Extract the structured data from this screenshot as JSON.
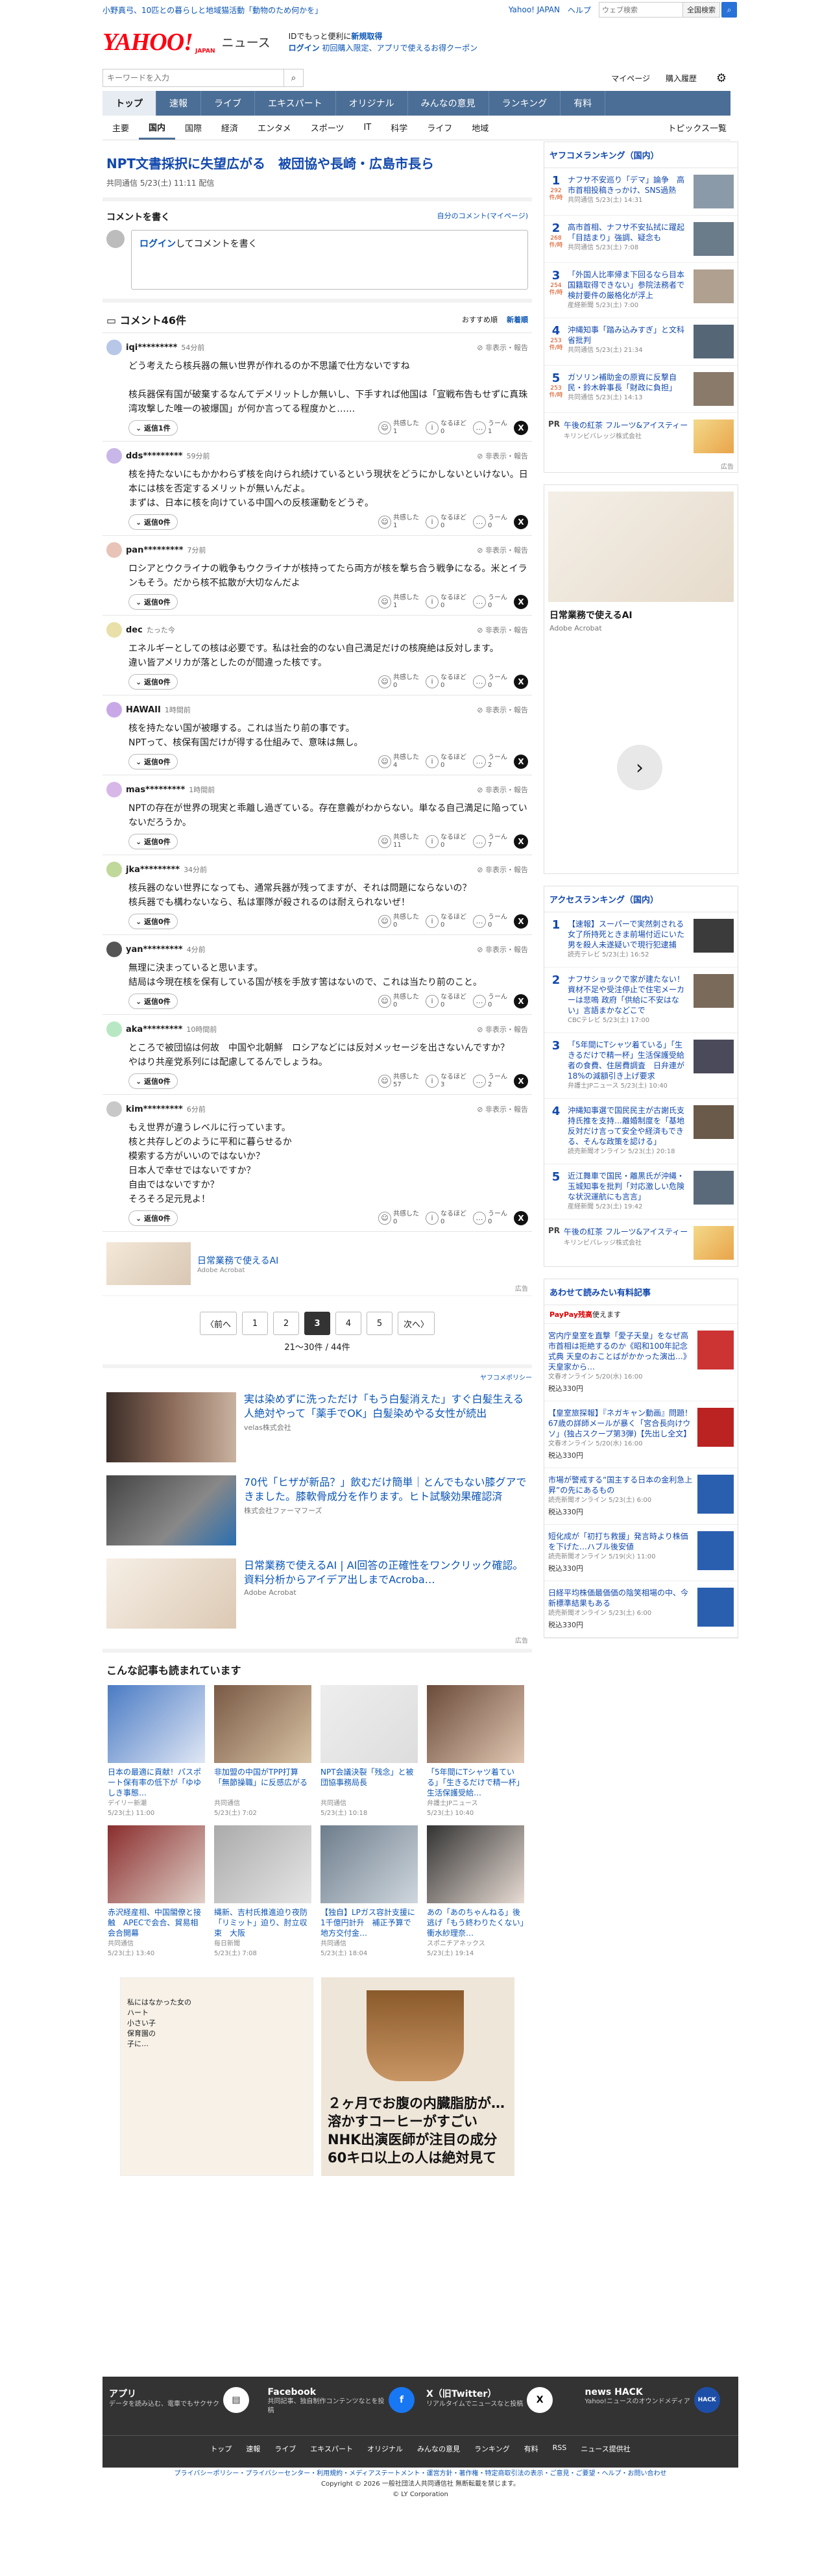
{
  "topbar": {
    "promo": "小野真弓、10匹との暮らしと地域猫活動「動物のため何かを」",
    "links": [
      "Yahoo! JAPAN",
      "ヘルプ"
    ],
    "search_placeholder": "ウェブ検索",
    "search_button": "全国検索"
  },
  "header": {
    "logo": "YAHOO!",
    "logo_sub": "JAPAN",
    "service": "ニュース",
    "promo1": "IDでもっと便利に",
    "promo1b": "新規取得",
    "promo2a": "ログイン",
    "promo2b": "初回購入限定、アプリで使えるお得クーポン"
  },
  "search": {
    "placeholder": "キーワードを入力",
    "mypage": "マイページ",
    "history": "購入履歴"
  },
  "nav": [
    "トップ",
    "速報",
    "ライブ",
    "エキスパート",
    "オリジナル",
    "みんなの意見",
    "ランキング",
    "有料"
  ],
  "subnav": [
    "主要",
    "国内",
    "国際",
    "経済",
    "エンタメ",
    "スポーツ",
    "IT",
    "科学",
    "ライフ",
    "地域"
  ],
  "subnav_right": "トピックス一覧",
  "article": {
    "title": "NPT文書採択に失望広がる　被団協や長崎・広島市長ら",
    "source": "共同通信",
    "date": "5/23(土) 11:11",
    "status": "配信"
  },
  "write": {
    "heading": "コメントを書く",
    "my_comments": "自分のコメント(マイページ)",
    "login": "ログイン",
    "rest": "してコメントを書く"
  },
  "comments_header": {
    "title": "コメント46件",
    "sort1": "おすすめ順",
    "sort2": "新着順"
  },
  "comments": [
    {
      "name": "iqi*********",
      "time": "54分前",
      "body": "どう考えたら核兵器の無い世界が作れるのか不思議で仕方ないですね\n\n核兵器保有国が破棄するなんてデメリットしか無いし、下手すれば他国は「宣戦布告もせずに真珠湾攻撃した唯一の被爆国」が何か言ってる程度かと……",
      "replies": "返信1件",
      "a": "1",
      "b": "0",
      "c": "1"
    },
    {
      "name": "dds*********",
      "time": "59分前",
      "body": "核を持たないにもかかわらず核を向けられ続けているという現状をどうにかしないといけない。日本には核を否定するメリットが無いんだよ。\nまずは、日本に核を向けている中国への反核運動をどうぞ。",
      "replies": "返信0件",
      "a": "1",
      "b": "0",
      "c": "0"
    },
    {
      "name": "pan*********",
      "time": "7分前",
      "body": "ロシアとウクライナの戦争もウクライナが核持ってたら両方が核を撃ち合う戦争になる。米とイランもそう。だから核不拡散が大切なんだよ",
      "replies": "返信0件",
      "a": "1",
      "b": "0",
      "c": "0"
    },
    {
      "name": "dec",
      "time": "たった今",
      "body": "エネルギーとしての核は必要です。私は社会的のない自己満足だけの核廃絶は反対します。\n違い皆アメリカが落としたのが間違った核です。",
      "replies": "返信0件",
      "a": "0",
      "b": "0",
      "c": "0"
    },
    {
      "name": "HAWAII",
      "time": "1時間前",
      "body": "核を持たない国が被曝する。これは当たり前の事です。\nNPTって、核保有国だけが得する仕組みで、意味は無し。",
      "replies": "返信0件",
      "a": "4",
      "b": "0",
      "c": "2"
    },
    {
      "name": "mas*********",
      "time": "1時間前",
      "body": "NPTの存在が世界の現実と乖離し過ぎている。存在意義がわからない。単なる自己満足に陥っていないだろうか。",
      "replies": "返信0件",
      "a": "11",
      "b": "0",
      "c": "7"
    },
    {
      "name": "jka*********",
      "time": "34分前",
      "body": "核兵器のない世界になっても、通常兵器が残ってますが、それは問題にならないの？\n核兵器でも構わないなら、私は軍隊が殺されるのは耐えられないぜ！",
      "replies": "返信0件",
      "a": "0",
      "b": "0",
      "c": "0"
    },
    {
      "name": "yan*********",
      "time": "4分前",
      "body": "無理に決まっていると思います。\n結局は今現在核を保有している国が核を手放す筈はないので、これは当たり前のこと。",
      "replies": "返信0件",
      "a": "0",
      "b": "0",
      "c": "0"
    },
    {
      "name": "aka*********",
      "time": "10時間前",
      "body": "ところで被団協は何故　中国や北朝鮮　ロシアなどには反対メッセージを出さないんですか？\nやはり共産党系列には配慮してるんでしょうね。",
      "replies": "返信0件",
      "a": "57",
      "b": "3",
      "c": "2"
    },
    {
      "name": "kim*********",
      "time": "6分前",
      "body": "もえ世界が違うレベルに行っています。\n核と共存しどのように平和に暮らせるか\n模索する方がいいのではないか？\n日本人で幸せではないですか？\n自由ではないですか？\nそろそろ足元見よ！",
      "replies": "返信0件",
      "a": "0",
      "b": "0",
      "c": "0"
    }
  ],
  "react_labels": {
    "a": "共感した",
    "b": "なるほど",
    "c": "うーん"
  },
  "report": "非表示・報告",
  "inline_ad": {
    "title": "日常業務で使えるAI",
    "sponsor": "Adobe Acrobat",
    "label": "広告"
  },
  "pager": {
    "prev": "前へ",
    "pages": [
      "1",
      "2",
      "3",
      "4",
      "5"
    ],
    "next": "次へ",
    "count": "21〜30件 / 44件"
  },
  "policy": "ヤフコメポリシー",
  "ads": [
    {
      "text": "実は染めずに洗っただけ「もう白髪消えた」すぐ白髪生える人絶対やって「薬手でOK」白髪染めやる女性が続出",
      "sponsor": "velas株式会社"
    },
    {
      "text": "70代「ヒザが新品？」飲むだけ簡単｜とんでもない膝グアできました。膝軟骨成分を作ります。ヒト試験効果確認済",
      "sponsor": "株式会社ファーマフーズ"
    },
    {
      "text": "日常業務で使えるAI | AI回答の正確性をワンクリック確認。資料分析からアイデア出しまでAcroba…",
      "sponsor": "Adobe Acrobat"
    }
  ],
  "ad_label": "広告",
  "recommend": {
    "title": "こんな記事も読まれています",
    "items": [
      {
        "t": "日本の最適に貢献！パスポート保有率の低下が「ゆゆしき事態…",
        "s": "デイリー新潮",
        "d": "5/23(土) 11:00"
      },
      {
        "t": "非加盟の中国がTPP打算「無節操職」に反感広がる",
        "s": "共同通信",
        "d": "5/23(土) 7:02"
      },
      {
        "t": "NPT会議決裂「残念」と被団協事務局長",
        "s": "共同通信",
        "d": "5/23(土) 10:18"
      },
      {
        "t": "「5年間にTシャツ着ている」「生きるだけで精一杯」生活保護受給…",
        "s": "弁護士JPニュース",
        "d": "5/23(土) 10:40"
      },
      {
        "t": "赤沢経産相、中国閣僚と接触　APECで会合、貿易相会合開幕",
        "s": "共同通信",
        "d": "5/23(土) 13:40"
      },
      {
        "t": "縄新、吉村氏推進迫り夜防「リミット」迫り、肘立収束　大阪",
        "s": "毎日新聞",
        "d": "5/23(土) 7:08"
      },
      {
        "t": "【独自】LPガス容計支援に1千億円計升　補正予算で地方交付金…",
        "s": "共同通信",
        "d": "5/23(土) 18:04"
      },
      {
        "t": "あの「あのちゃんねる」後逃げ「もう終わりたくない」衝水紗理奈…",
        "s": "スポニチアネックス",
        "d": "5/23(土) 19:14"
      }
    ]
  },
  "bigad": {
    "left_text": "私にはなかった女の\nハート\n小さい子\n保育園の\n子に…",
    "right_text": "２ヶ月でお腹の内臓脂肪が…\n溶かすコーヒーがすごい\nNHK出演医師が注目の成分\n60キロ以上の人は絶対見て",
    "label": "広告"
  },
  "side": {
    "ranking_title": "ヤフコメランキング（国内）",
    "ranking": [
      {
        "t": "ナフサ不安巡り「デマ」論争　高市首相投稿きっかけ、SNS過熱",
        "m": "共同通信 5/23(土) 14:31",
        "c": "292",
        "u": "件/時"
      },
      {
        "t": "高市首相、ナフサ不安払拭に躍起「目詰まり」強調、疑念も",
        "m": "共同通信 5/23(土) 7:08",
        "c": "268",
        "u": "件/時"
      },
      {
        "t": "「外国人比率帰ま下回るなら目本国籍取得できない」参院法務者で検討要件の厳格化が浮上",
        "m": "産経新聞 5/23(土) 7:00",
        "c": "254",
        "u": "件/時"
      },
      {
        "t": "沖縄知事「踏み込みすぎ」と文科省批判",
        "m": "共同通信 5/23(土) 21:34",
        "c": "253",
        "u": "件/時"
      },
      {
        "t": "ガソリン補助金の原資に反撃自民・鈴木幹事長「財政に負担」",
        "m": "共同通信 5/23(土) 14:13",
        "c": "253",
        "u": "件/時"
      }
    ],
    "ranking_pr": {
      "t": "午後の紅茶 フルーツ&アイスティー",
      "m": "キリンビバレッジ株式会社"
    },
    "sidead": {
      "title": "日常業務で使えるAI",
      "sponsor": "Adobe Acrobat"
    },
    "access_title": "アクセスランキング（国内）",
    "access": [
      {
        "t": "【速報】スーパーで実然刺される女了所持死ときま前場付近にいた男を殺人未遂疑いで現行犯逮捕",
        "m": "読売テレビ 5/23(土) 16:52"
      },
      {
        "t": "ナフサショックで家が建たない！資材不足や受注停止で住宅メーカーは悲鳴 政府「供給に不安はない」言語まかなどこで",
        "m": "CBCテレビ 5/23(土) 17:00"
      },
      {
        "t": "「5年間にTシャツ着ている」「生きるだけで精一杯」生活保護受給者の食費、住居費調査　日弁連が18%の減額引き上げ要求",
        "m": "弁護士JPニュース 5/23(土) 10:40"
      },
      {
        "t": "沖縄知事選で国民民主が古謝氏支持氏推を支持…離婚制度を「基地反対だけ言って安全や経済もできる、そんな政策を認ける」",
        "m": "読売新聞オンライン 5/23(土) 20:18"
      },
      {
        "t": "近江舞車で国民・離黒氏が沖縄・玉城知事を批判「対応激しい危険な状況運航にも言言」",
        "m": "産経新聞 5/23(土) 19:42"
      }
    ],
    "access_pr": {
      "t": "午後の紅茶 フルーツ&アイスティー",
      "m": "キリンビバレッジ株式会社"
    },
    "paid_title": "あわせて読みたい有料記事",
    "paypay": "PayPay残高",
    "paypay_rest": "使えます",
    "paid": [
      {
        "t": "宮内庁皇室を直撃「愛子天皇」をなぜ高市首相は拒絶するのか《昭和100年記念式典 天皇のおことばがかかった演出…》天皇家から…",
        "m": "文春オンライン 5/20(水) 16:00",
        "p": "税込330円"
      },
      {
        "t": "【皇室旅探報】『ネガキャン動画』問題！ 67歳の詳師メールが暴く「宮合長向けウソ」(独占スクープ第3弾)【先出し全文】",
        "m": "文春オンライン 5/20(水) 16:00",
        "p": "税込330円"
      },
      {
        "t": "市場が警戒する“国主する日本の金利急上昇”の先にあるもの",
        "m": "読売新聞オンライン 5/23(土) 6:00",
        "p": "税込330円"
      },
      {
        "t": "短化成が「初打ち救援」発言時より株価を下げた…ハブル後安値",
        "m": "読売新聞オンライン 5/19(火) 11:00",
        "p": "税込330円"
      },
      {
        "t": "日経平均株価最価価の陰笑相場の中、今新標準結果もある",
        "m": "読売新聞オンライン 5/23(土) 6:00",
        "p": "税込330円"
      }
    ]
  },
  "footer": {
    "apps": [
      {
        "n": "アプリ",
        "d": "データを読み込む、電車でもサクサク"
      },
      {
        "n": "Facebook",
        "d": "共同記事、独自制作コンテンツなとを投稿"
      },
      {
        "n": "X（旧Twitter）",
        "d": "リアルタイムでニュースなと投稿"
      },
      {
        "n": "news HACK",
        "d": "Yahoo!ニュースのオウンドメディア"
      }
    ],
    "links": [
      "トップ",
      "速報",
      "ライブ",
      "エキスパート",
      "オリジナル",
      "みんなの意見",
      "ランキング",
      "有料",
      "RSS",
      "ニュース提供社"
    ],
    "legal": "プライバシーポリシー・プライバシーセンター・利用規約・メディアステートメント・運営方針・著作権・特定商取引法の表示・ご意見・ご要望・ヘルプ・お問い合わせ",
    "copy1": "Copyright © 2026 一般社団法人共同通信社 無断転載を禁じます。",
    "copy2": "© LY Corporation"
  }
}
